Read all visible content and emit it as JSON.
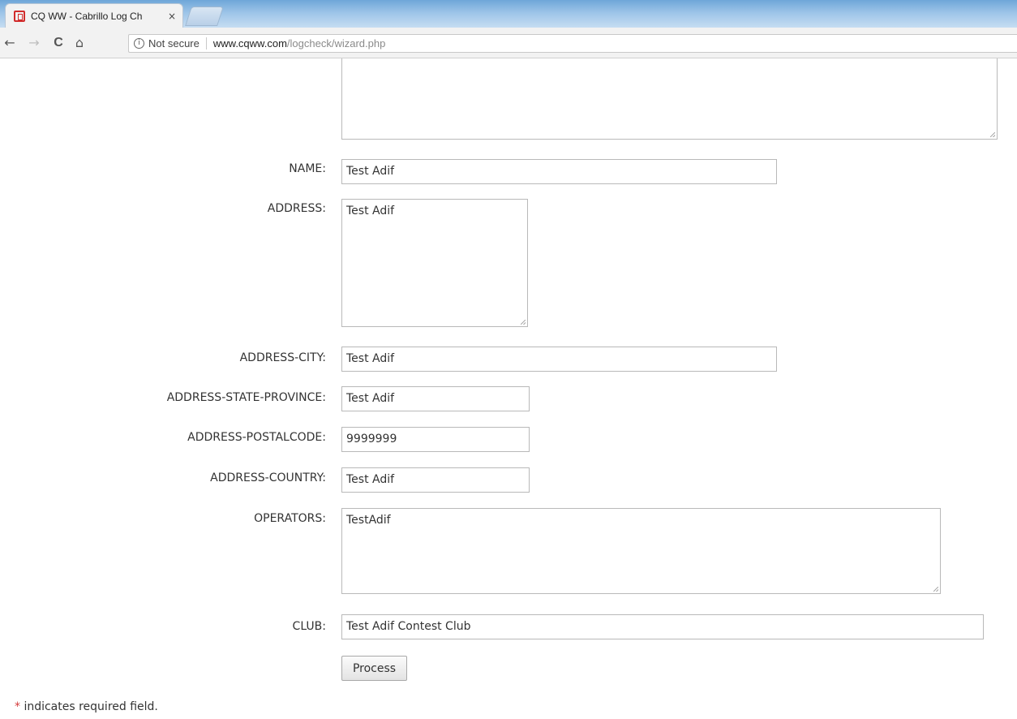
{
  "browser": {
    "tab_title": "CQ WW - Cabrillo Log Ch",
    "tab_close": "×",
    "back": "←",
    "forward": "→",
    "reload": "C",
    "home": "⌂",
    "info_glyph": "i",
    "security_label": "Not secure",
    "url_host": "www.cqww.com",
    "url_path": "/logcheck/wizard.php"
  },
  "form": {
    "name_label": "NAME:",
    "name_value": "Test Adif",
    "address_label": "ADDRESS:",
    "address_value": "Test Adif",
    "city_label": "ADDRESS-CITY:",
    "city_value": "Test Adif",
    "state_label": "ADDRESS-STATE-PROVINCE:",
    "state_value": "Test Adif",
    "postal_label": "ADDRESS-POSTALCODE:",
    "postal_value": "9999999",
    "country_label": "ADDRESS-COUNTRY:",
    "country_value": "Test Adif",
    "operators_label": "OPERATORS:",
    "operators_value": "TestAdif",
    "club_label": "CLUB:",
    "club_value": "Test Adif Contest Club",
    "submit_label": "Process"
  },
  "footer": {
    "asterisk": "*",
    "required_note": " indicates required field."
  },
  "colors": {
    "asterisk": "#d43b3b",
    "tab_strip": "#9cc4e8",
    "favicon": "#d12b2b"
  }
}
